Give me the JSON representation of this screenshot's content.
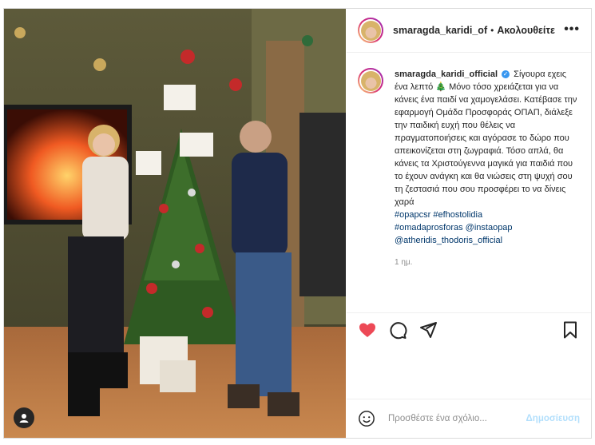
{
  "header": {
    "username": "smaragda_karidi_of",
    "separator": "•",
    "follow_label": "Ακολουθείτε",
    "more_label": "•••"
  },
  "caption": {
    "username": "smaragda_karidi_official",
    "verified_mark": "✓",
    "text": "Σίγουρα εχεις ένα λεπτό 🎄 Μόνο τόσο χρειάζεται για να κάνεις ένα παιδί να χαμογελάσει. Κατέβασε την εφαρμογή Ομάδα Προσφοράς ΟΠΑΠ, διάλεξε την παιδική ευχή που θέλεις να πραγματοποιήσεις και αγόρασε το δώρο που απεικονίζεται στη ζωγραφιά. Τόσο απλά, θα κάνεις τα Χριστούγεννα μαγικά για παιδιά που το έχουν ανάγκη και θα νιώσεις στη ψυχή σου τη ζεστασιά που σου προσφέρει το να δίνεις χαρά",
    "hashtags": [
      "#opapcsr",
      "#efhostolidia",
      "#omadaprosforas",
      "@instaopap",
      "@atheridis_thodoris_official"
    ],
    "time": "1 ημ."
  },
  "actions": {
    "like_icon": "heart-icon",
    "comment_icon": "comment-icon",
    "share_icon": "share-icon",
    "save_icon": "bookmark-icon",
    "like_color": "#ed4956"
  },
  "comment_box": {
    "placeholder": "Προσθέστε ένα σχόλιο...",
    "post_label": "Δημοσίευση"
  },
  "photo": {
    "tag_icon": "user-tag-icon"
  }
}
